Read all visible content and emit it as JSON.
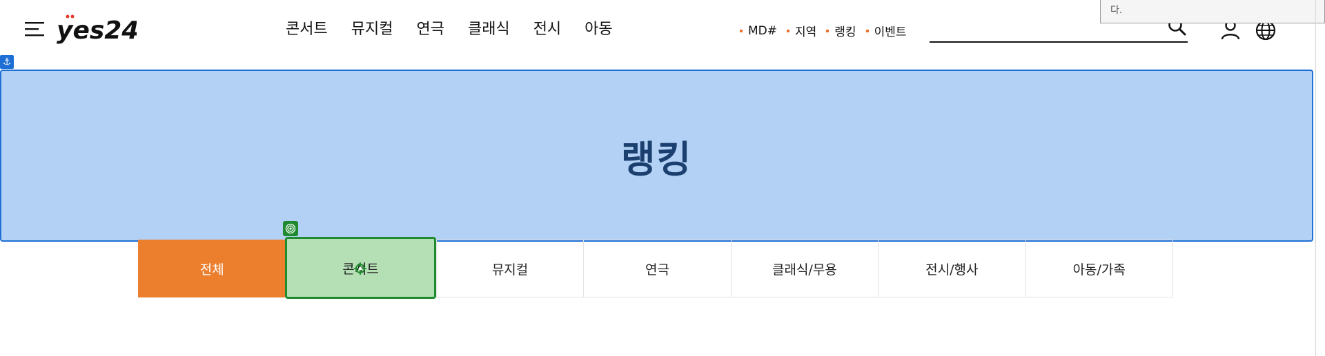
{
  "header": {
    "logo_text": "yes24",
    "nav": [
      "콘서트",
      "뮤지컬",
      "연극",
      "클래식",
      "전시",
      "아동"
    ],
    "sub_links": [
      "MD#",
      "지역",
      "랭킹",
      "이벤트"
    ],
    "search": {
      "value": "",
      "placeholder": ""
    },
    "tooltip_text": "다."
  },
  "hero": {
    "title": "랭킹"
  },
  "tabs": [
    "전체",
    "콘서트",
    "뮤지컬",
    "연극",
    "클래식/무용",
    "전시/행사",
    "아동/가족"
  ],
  "annotations": {
    "anchor_icon": "anchor-icon",
    "target_icon": "target-icon",
    "click_icon": "crosshair-icon"
  },
  "colors": {
    "accent_orange": "#ec7f2e",
    "hero_fill": "#b3d1f5",
    "hero_border": "#1d6fd6",
    "highlight_fill": "#b5dfb5",
    "highlight_border": "#1f8a2e"
  }
}
